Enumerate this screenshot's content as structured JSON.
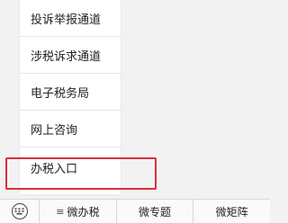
{
  "popup_menu": {
    "items": [
      {
        "label": "投诉举报通道"
      },
      {
        "label": "涉税诉求通道"
      },
      {
        "label": "电子税务局"
      },
      {
        "label": "网上咨询"
      },
      {
        "label": "办税入口"
      }
    ]
  },
  "highlight_color": "#d9303a",
  "bottom_bar": {
    "keyboard_icon": "keyboard-icon",
    "tabs": [
      {
        "label": "微办税",
        "icon": "menu-icon",
        "glyph": "≡"
      },
      {
        "label": "微专题"
      },
      {
        "label": "微矩阵"
      }
    ]
  }
}
